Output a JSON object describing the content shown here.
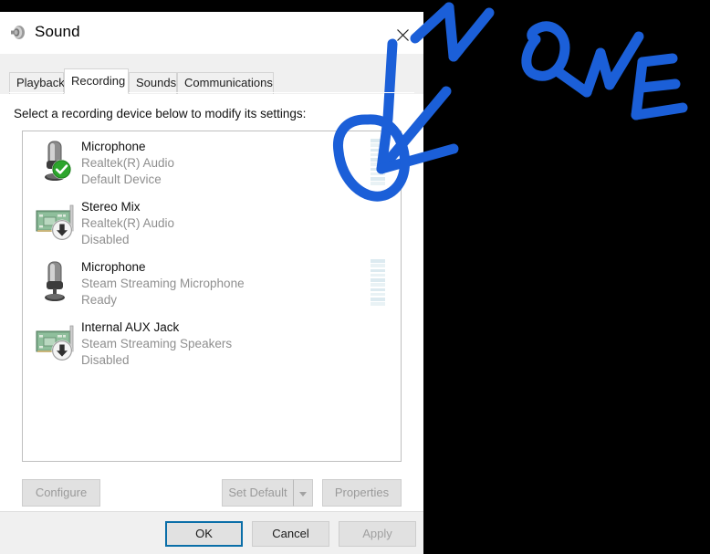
{
  "window": {
    "title": "Sound",
    "title_icon": "speaker-icon",
    "close_icon": "close-icon"
  },
  "tabs": [
    {
      "label": "Playback",
      "active": false
    },
    {
      "label": "Recording",
      "active": true
    },
    {
      "label": "Sounds",
      "active": false
    },
    {
      "label": "Communications",
      "active": false
    }
  ],
  "page": {
    "instruction": "Select a recording device below to modify its settings:"
  },
  "devices": [
    {
      "name": "Microphone",
      "driver": "Realtek(R) Audio",
      "status": "Default Device",
      "icon": "microphone-icon",
      "badge": "green-check-badge",
      "meter": true,
      "meter_levels": [
        1,
        1,
        0,
        1,
        0,
        1,
        0,
        1,
        0,
        1
      ]
    },
    {
      "name": "Stereo Mix",
      "driver": "Realtek(R) Audio",
      "status": "Disabled",
      "icon": "sound-card-icon",
      "badge": "down-arrow-badge",
      "meter": false,
      "meter_levels": []
    },
    {
      "name": "Microphone",
      "driver": "Steam Streaming Microphone",
      "status": "Ready",
      "icon": "microphone-icon",
      "badge": "none",
      "meter": true,
      "meter_levels": [
        1,
        0,
        1,
        0,
        1,
        0,
        1,
        0,
        1,
        0
      ]
    },
    {
      "name": "Internal AUX Jack",
      "driver": "Steam Streaming Speakers",
      "status": "Disabled",
      "icon": "sound-card-icon",
      "badge": "down-arrow-badge",
      "meter": false,
      "meter_levels": []
    }
  ],
  "actions": {
    "configure": "Configure",
    "set_default": "Set Default",
    "set_default_caret": "chevron-down-icon",
    "properties": "Properties"
  },
  "footer": {
    "ok": "OK",
    "cancel": "Cancel",
    "apply": "Apply"
  },
  "annotation": {
    "text": "NONE",
    "color": "#1b5fd8",
    "marks": [
      "arrow-pointing-to-meter",
      "circle-around-meter"
    ]
  },
  "colors": {
    "accent_blue": "#1b5fd8",
    "focus_border": "#0a6ea8",
    "disabled_text": "#9a9a9a",
    "subtext": "#8f8f8f",
    "meter_segment": "#dceaf0",
    "window_bg": "#f0f0f0"
  }
}
